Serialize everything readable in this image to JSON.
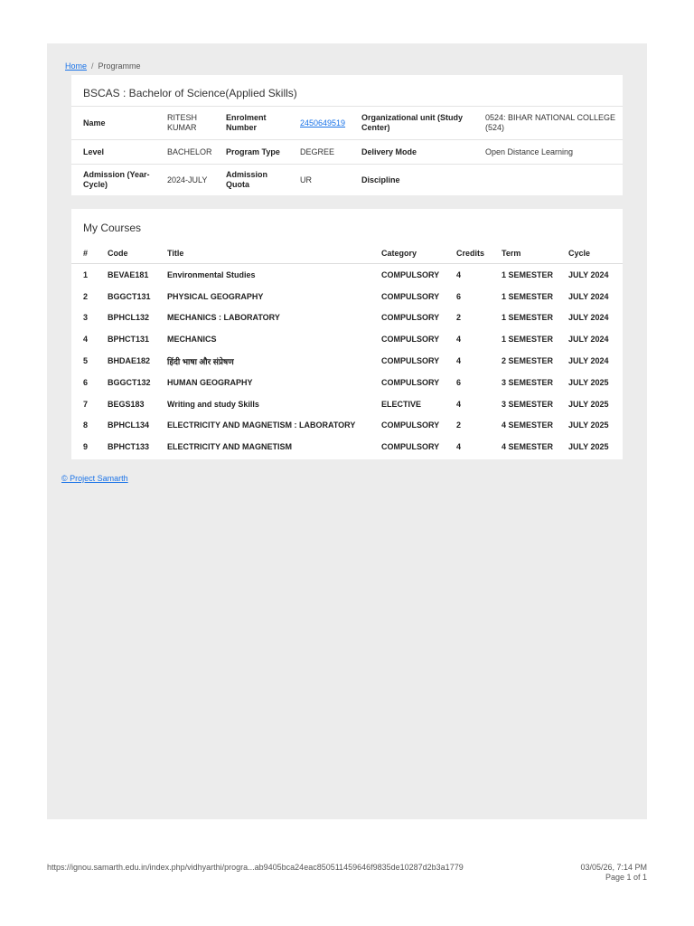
{
  "breadcrumb": {
    "home": "Home",
    "separator": "/",
    "current": "Programme"
  },
  "programme": {
    "title": "BSCAS : Bachelor of Science(Applied Skills)",
    "fields": {
      "name_label": "Name",
      "name_value": "RITESH KUMAR",
      "enrolment_label": "Enrolment Number",
      "enrolment_value": "2450649519",
      "org_label": "Organizational unit (Study Center)",
      "org_value": "0524: BIHAR NATIONAL COLLEGE (524)",
      "level_label": "Level",
      "level_value": "BACHELOR",
      "program_type_label": "Program Type",
      "program_type_value": "DEGREE",
      "delivery_label": "Delivery Mode",
      "delivery_value": "Open Distance Learning",
      "admission_label": "Admission (Year-Cycle)",
      "admission_value": "2024-JULY",
      "quota_label": "Admission Quota",
      "quota_value": "UR",
      "discipline_label": "Discipline",
      "discipline_value": ""
    }
  },
  "courses": {
    "title": "My Courses",
    "headers": [
      "#",
      "Code",
      "Title",
      "Category",
      "Credits",
      "Term",
      "Cycle"
    ],
    "rows": [
      [
        "1",
        "BEVAE181",
        "Environmental Studies",
        "COMPULSORY",
        "4",
        "1 SEMESTER",
        "JULY 2024"
      ],
      [
        "2",
        "BGGCT131",
        "PHYSICAL GEOGRAPHY",
        "COMPULSORY",
        "6",
        "1 SEMESTER",
        "JULY 2024"
      ],
      [
        "3",
        "BPHCL132",
        "MECHANICS : LABORATORY",
        "COMPULSORY",
        "2",
        "1 SEMESTER",
        "JULY 2024"
      ],
      [
        "4",
        "BPHCT131",
        "MECHANICS",
        "COMPULSORY",
        "4",
        "1 SEMESTER",
        "JULY 2024"
      ],
      [
        "5",
        "BHDAE182",
        "हिंदी भाषा और संप्रेषण",
        "COMPULSORY",
        "4",
        "2 SEMESTER",
        "JULY 2024"
      ],
      [
        "6",
        "BGGCT132",
        "HUMAN GEOGRAPHY",
        "COMPULSORY",
        "6",
        "3 SEMESTER",
        "JULY 2025"
      ],
      [
        "7",
        "BEGS183",
        "Writing and study Skills",
        "ELECTIVE",
        "4",
        "3 SEMESTER",
        "JULY 2025"
      ],
      [
        "8",
        "BPHCL134",
        "ELECTRICITY AND MAGNETISM : LABORATORY",
        "COMPULSORY",
        "2",
        "4 SEMESTER",
        "JULY 2025"
      ],
      [
        "9",
        "BPHCT133",
        "ELECTRICITY AND MAGNETISM",
        "COMPULSORY",
        "4",
        "4 SEMESTER",
        "JULY 2025"
      ]
    ]
  },
  "footer": {
    "link": "© Project Samarth"
  },
  "print_footer": {
    "url": "https://ignou.samarth.edu.in/index.php/vidhyarthi/progra...ab9405bca24eac850511459646f9835de10287d2b3a1779",
    "datetime": "03/05/26, 7:14 PM",
    "page": "Page 1 of 1"
  }
}
